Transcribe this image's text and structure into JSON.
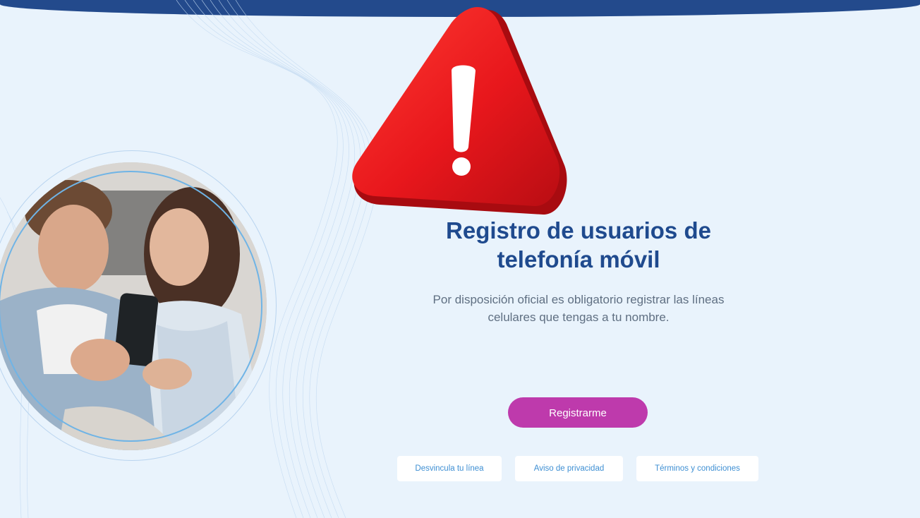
{
  "hero": {
    "title_line1": "Registro de usuarios de",
    "title_line2": "telefonía móvil",
    "subtitle_line1": "Por disposición oficial es obligatorio registrar las líneas",
    "subtitle_line2": "celulares que tengas a tu nombre."
  },
  "actions": {
    "register_label": "Registrarme",
    "links": [
      {
        "label": "Desvincula tu línea"
      },
      {
        "label": "Aviso de privacidad"
      },
      {
        "label": "Términos y condiciones"
      }
    ]
  },
  "icons": {
    "warning": "warning-triangle-icon"
  },
  "colors": {
    "header": "#234a8c",
    "background": "#e9f3fc",
    "title": "#1f4a8e",
    "primary_button": "#be3aac",
    "link_text": "#3e8fd3",
    "warning": "#e8171c"
  }
}
